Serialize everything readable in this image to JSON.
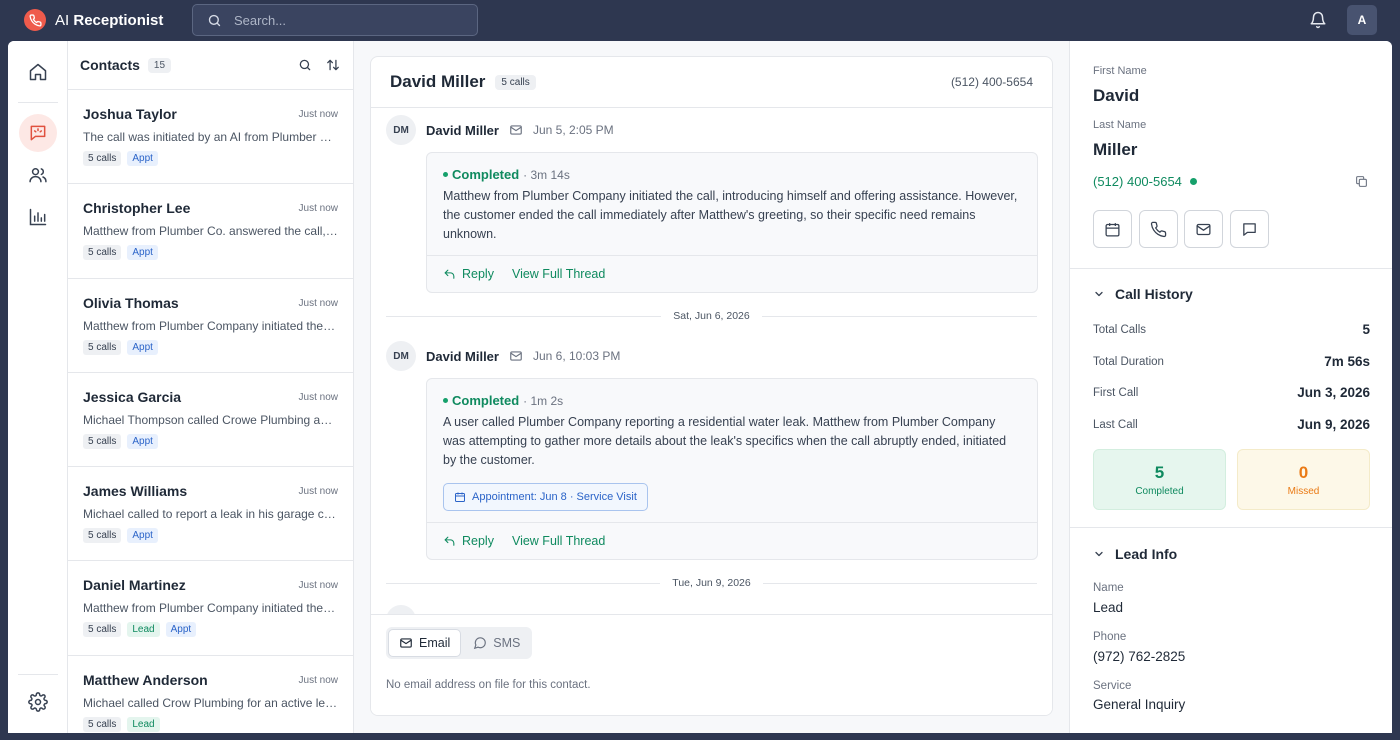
{
  "app": {
    "name_prefix": "AI",
    "name_bold": "Receptionist",
    "brand_color": "#ef5b4c"
  },
  "search": {
    "placeholder": "Search..."
  },
  "user": {
    "avatar_initial": "A"
  },
  "contacts": {
    "title": "Contacts",
    "count": "15",
    "items": [
      {
        "name": "Joshua Taylor",
        "time": "Just now",
        "snippet": "The call was initiated by an AI from Plumber Company...",
        "tags": [
          "5 calls",
          "Appt"
        ]
      },
      {
        "name": "Christopher Lee",
        "time": "Just now",
        "snippet": "Matthew from Plumber Co. answered the call, offering...",
        "tags": [
          "5 calls",
          "Appt"
        ]
      },
      {
        "name": "Olivia Thomas",
        "time": "Just now",
        "snippet": "Matthew from Plumber Company initiated the call...",
        "tags": [
          "5 calls",
          "Appt"
        ]
      },
      {
        "name": "Jessica Garcia",
        "time": "Just now",
        "snippet": "Michael Thompson called Crowe Plumbing about a leak...",
        "tags": [
          "5 calls",
          "Appt"
        ]
      },
      {
        "name": "James Williams",
        "time": "Just now",
        "snippet": "Michael called to report a leak in his garage ceiling...",
        "tags": [
          "5 calls",
          "Appt"
        ]
      },
      {
        "name": "Daniel Martinez",
        "time": "Just now",
        "snippet": "Matthew from Plumber Company initiated the call...",
        "tags": [
          "5 calls",
          "Lead",
          "Appt"
        ]
      },
      {
        "name": "Matthew Anderson",
        "time": "Just now",
        "snippet": "Michael called Crow Plumbing for an active leak...",
        "tags": [
          "5 calls",
          "Lead"
        ]
      }
    ]
  },
  "conversation": {
    "name": "David Miller",
    "calls_badge": "5 calls",
    "phone": "(512) 400-5654",
    "messages": [
      {
        "initials": "DM",
        "sender": "David Miller",
        "date": "Jun 5, 2:05 PM",
        "status": "Completed",
        "duration": "· 3m 14s",
        "text": "Matthew from Plumber Company initiated the call, introducing himself and offering assistance. However, the customer ended the call immediately after Matthew's greeting, so their specific need remains unknown.",
        "reply": "Reply",
        "view": "View Full Thread"
      },
      {
        "initials": "DM",
        "sender": "David Miller",
        "date": "Jun 6, 10:03 PM",
        "status": "Completed",
        "duration": "· 1m 2s",
        "text": "A user called Plumber Company reporting a residential water leak. Matthew from Plumber Company was attempting to gather more details about the leak's specifics when the call abruptly ended, initiated by the customer.",
        "appointment": "Appointment: Jun 8 · Service Visit",
        "reply": "Reply",
        "view": "View Full Thread"
      }
    ],
    "dividers": [
      "Sat, Jun 6, 2026",
      "Tue, Jun 9, 2026"
    ],
    "tabs": {
      "email": "Email",
      "sms": "SMS"
    },
    "footer_note": "No email address on file for this contact."
  },
  "details": {
    "first_name_label": "First Name",
    "first_name": "David",
    "last_name_label": "Last Name",
    "last_name": "Miller",
    "phone": "(512) 400-5654",
    "call_history": {
      "title": "Call History",
      "rows": [
        {
          "label": "Total Calls",
          "value": "5"
        },
        {
          "label": "Total Duration",
          "value": "7m 56s"
        },
        {
          "label": "First Call",
          "value": "Jun 3, 2026"
        },
        {
          "label": "Last Call",
          "value": "Jun 9, 2026"
        }
      ],
      "completed": {
        "value": "5",
        "label": "Completed"
      },
      "missed": {
        "value": "0",
        "label": "Missed"
      }
    },
    "lead_info": {
      "title": "Lead Info",
      "name_label": "Name",
      "name": "Lead",
      "phone_label": "Phone",
      "phone": "(972) 762-2825",
      "service_label": "Service",
      "service": "General Inquiry"
    }
  }
}
